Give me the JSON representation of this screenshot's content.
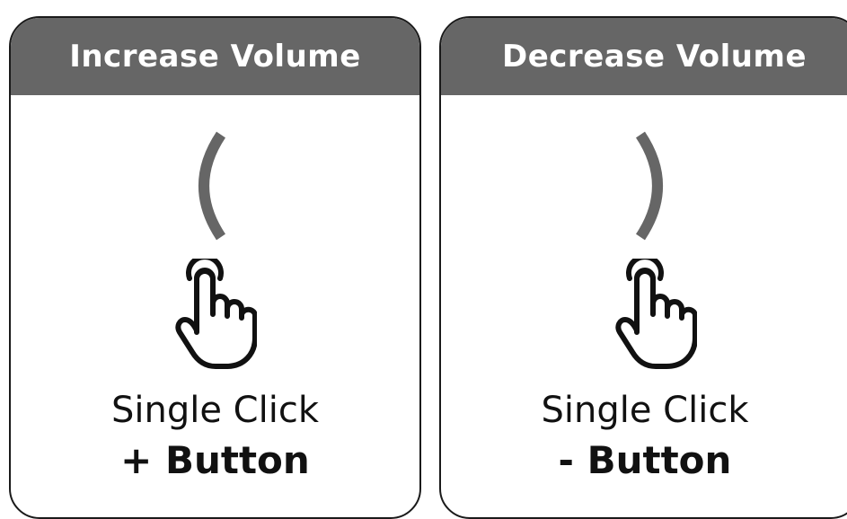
{
  "colors": {
    "header_bg": "#666666",
    "header_text": "#ffffff",
    "border": "#1a1a1a",
    "bracket": "#666666",
    "text": "#111111"
  },
  "cards": [
    {
      "title": "Increase Volume",
      "bracket_icon": "left-bracket-arc",
      "hand_icon": "tap-hand-icon",
      "action": "Single Click",
      "button": "+ Button"
    },
    {
      "title": "Decrease Volume",
      "bracket_icon": "right-bracket-arc",
      "hand_icon": "tap-hand-icon",
      "action": "Single Click",
      "button": "- Button"
    }
  ]
}
